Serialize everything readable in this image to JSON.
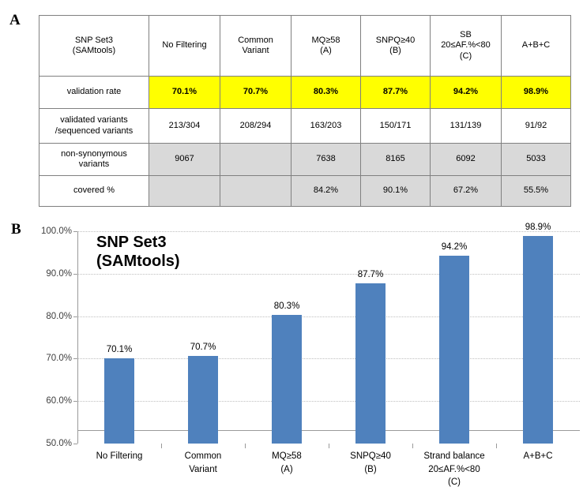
{
  "panels": {
    "a_label": "A",
    "b_label": "B"
  },
  "table": {
    "corner_label_line1": "SNP Set3",
    "corner_label_line2": "(SAMtools)",
    "columns": [
      {
        "line1": "No Filtering",
        "line2": "",
        "line3": ""
      },
      {
        "line1": "Common",
        "line2": "Variant",
        "line3": ""
      },
      {
        "line1": "MQ≥58",
        "line2": "(A)",
        "line3": ""
      },
      {
        "line1": "SNPQ≥40",
        "line2": "(B)",
        "line3": ""
      },
      {
        "line1": "SB",
        "line2": "20≤AF.%<80",
        "line3": "(C)"
      },
      {
        "line1": "A+B+C",
        "line2": "",
        "line3": ""
      }
    ],
    "rows": [
      {
        "label_line1": "validation rate",
        "label_line2": "",
        "style": "yellow",
        "values": [
          "70.1%",
          "70.7%",
          "80.3%",
          "87.7%",
          "94.2%",
          "98.9%"
        ]
      },
      {
        "label_line1": "validated variants",
        "label_line2": "/sequenced  variants",
        "style": "white",
        "values": [
          "213/304",
          "208/294",
          "163/203",
          "150/171",
          "131/139",
          "91/92"
        ]
      },
      {
        "label_line1": "non-synonymous",
        "label_line2": "variants",
        "style": "grey",
        "values": [
          "9067",
          "",
          "7638",
          "8165",
          "6092",
          "5033"
        ]
      },
      {
        "label_line1": "covered %",
        "label_line2": "",
        "style": "grey",
        "values": [
          "",
          "",
          "84.2%",
          "90.1%",
          "67.2%",
          "55.5%"
        ]
      }
    ]
  },
  "chart_data": {
    "type": "bar",
    "title": "SNP Set3\n(SAMtools)",
    "title_line1": "SNP Set3",
    "title_line2": "(SAMtools)",
    "xlabel": "",
    "ylabel": "",
    "ylim": [
      50.0,
      100.0
    ],
    "ytick_values": [
      50.0,
      60.0,
      70.0,
      80.0,
      90.0,
      100.0
    ],
    "ytick_labels": [
      "50.0%",
      "60.0%",
      "70.0%",
      "80.0%",
      "90.0%",
      "100.0%"
    ],
    "grid": true,
    "legend": false,
    "bar_color": "#4f81bd",
    "categories": [
      {
        "line1": "No Filtering",
        "line2": "",
        "line3": ""
      },
      {
        "line1": "Common",
        "line2": "Variant",
        "line3": ""
      },
      {
        "line1": "MQ≥58",
        "line2": "(A)",
        "line3": ""
      },
      {
        "line1": "SNPQ≥40",
        "line2": "(B)",
        "line3": ""
      },
      {
        "line1": "Strand balance",
        "line2": "20≤AF.%<80",
        "line3": "(C)"
      },
      {
        "line1": "A+B+C",
        "line2": "",
        "line3": ""
      }
    ],
    "values": [
      70.1,
      70.7,
      80.3,
      87.7,
      94.2,
      98.9
    ],
    "data_labels": [
      "70.1%",
      "70.7%",
      "80.3%",
      "87.7%",
      "94.2%",
      "98.9%"
    ]
  }
}
